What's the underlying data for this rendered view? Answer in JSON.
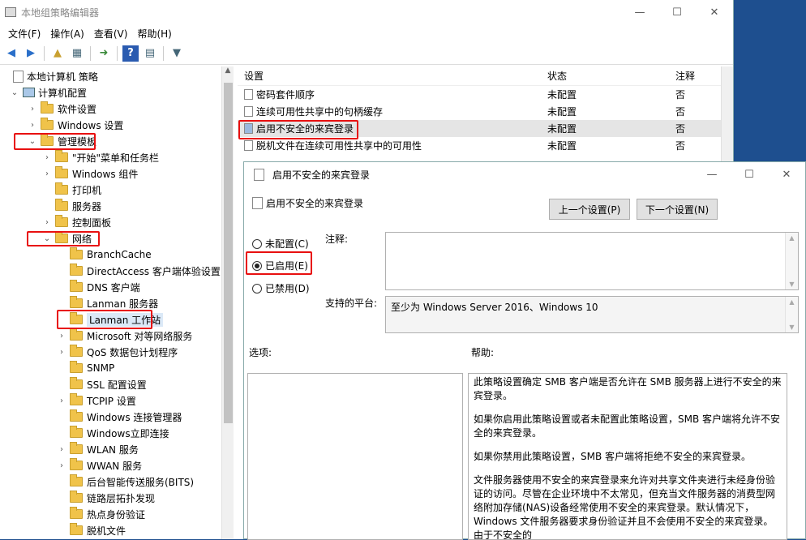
{
  "window": {
    "title": "本地组策略编辑器",
    "minimize": "—",
    "maximize": "☐",
    "close": "✕"
  },
  "menu": [
    "文件(F)",
    "操作(A)",
    "查看(V)",
    "帮助(H)"
  ],
  "tree": [
    {
      "label": "本地计算机 策略",
      "level": 0,
      "expanded": null,
      "type": "policy"
    },
    {
      "label": "计算机配置",
      "level": 1,
      "expanded": true,
      "type": "computer"
    },
    {
      "label": "软件设置",
      "level": 2,
      "expanded": false,
      "type": "folder"
    },
    {
      "label": "Windows 设置",
      "level": 2,
      "expanded": false,
      "type": "folder"
    },
    {
      "label": "管理模板",
      "level": 2,
      "expanded": true,
      "type": "folder"
    },
    {
      "label": "\"开始\"菜单和任务栏",
      "level": 3,
      "expanded": false,
      "type": "folder"
    },
    {
      "label": "Windows 组件",
      "level": 3,
      "expanded": false,
      "type": "folder"
    },
    {
      "label": "打印机",
      "level": 3,
      "expanded": null,
      "type": "folder"
    },
    {
      "label": "服务器",
      "level": 3,
      "expanded": null,
      "type": "folder"
    },
    {
      "label": "控制面板",
      "level": 3,
      "expanded": false,
      "type": "folder"
    },
    {
      "label": "网络",
      "level": 3,
      "expanded": true,
      "type": "folder"
    },
    {
      "label": "BranchCache",
      "level": 4,
      "expanded": null,
      "type": "folder"
    },
    {
      "label": "DirectAccess 客户端体验设置",
      "level": 4,
      "expanded": null,
      "type": "folder"
    },
    {
      "label": "DNS 客户端",
      "level": 4,
      "expanded": null,
      "type": "folder"
    },
    {
      "label": "Lanman 服务器",
      "level": 4,
      "expanded": null,
      "type": "folder"
    },
    {
      "label": "Lanman 工作站",
      "level": 4,
      "expanded": null,
      "type": "folder",
      "selected": true
    },
    {
      "label": "Microsoft 对等网络服务",
      "level": 4,
      "expanded": false,
      "type": "folder"
    },
    {
      "label": "QoS 数据包计划程序",
      "level": 4,
      "expanded": false,
      "type": "folder"
    },
    {
      "label": "SNMP",
      "level": 4,
      "expanded": null,
      "type": "folder"
    },
    {
      "label": "SSL 配置设置",
      "level": 4,
      "expanded": null,
      "type": "folder"
    },
    {
      "label": "TCPIP 设置",
      "level": 4,
      "expanded": false,
      "type": "folder"
    },
    {
      "label": "Windows 连接管理器",
      "level": 4,
      "expanded": null,
      "type": "folder"
    },
    {
      "label": "Windows立即连接",
      "level": 4,
      "expanded": null,
      "type": "folder"
    },
    {
      "label": "WLAN 服务",
      "level": 4,
      "expanded": false,
      "type": "folder"
    },
    {
      "label": "WWAN 服务",
      "level": 4,
      "expanded": false,
      "type": "folder"
    },
    {
      "label": "后台智能传送服务(BITS)",
      "level": 4,
      "expanded": null,
      "type": "folder"
    },
    {
      "label": "链路层拓扑发现",
      "level": 4,
      "expanded": null,
      "type": "folder"
    },
    {
      "label": "热点身份验证",
      "level": 4,
      "expanded": null,
      "type": "folder"
    },
    {
      "label": "脱机文件",
      "level": 4,
      "expanded": null,
      "type": "folder"
    }
  ],
  "list": {
    "headers": {
      "setting": "设置",
      "state": "状态",
      "comment": "注释"
    },
    "rows": [
      {
        "name": "密码套件顺序",
        "state": "未配置",
        "comment": "否"
      },
      {
        "name": "连续可用性共享中的句柄缓存",
        "state": "未配置",
        "comment": "否"
      },
      {
        "name": "启用不安全的来宾登录",
        "state": "未配置",
        "comment": "否",
        "selected": true
      },
      {
        "name": "脱机文件在连续可用性共享中的可用性",
        "state": "未配置",
        "comment": "否"
      }
    ]
  },
  "dialog": {
    "title": "启用不安全的来宾登录",
    "heading": "启用不安全的来宾登录",
    "prev_button": "上一个设置(P)",
    "next_button": "下一个设置(N)",
    "radios": [
      {
        "label": "未配置(C)",
        "checked": false
      },
      {
        "label": "已启用(E)",
        "checked": true
      },
      {
        "label": "已禁用(D)",
        "checked": false
      }
    ],
    "comment_label": "注释:",
    "platform_label": "支持的平台:",
    "platform_value": "至少为 Windows Server 2016、Windows 10",
    "options_label": "选项:",
    "help_label": "帮助:",
    "help_paragraphs": [
      "此策略设置确定 SMB 客户端是否允许在 SMB 服务器上进行不安全的来宾登录。",
      "如果你启用此策略设置或者未配置此策略设置，SMB 客户端将允许不安全的来宾登录。",
      "如果你禁用此策略设置，SMB 客户端将拒绝不安全的来宾登录。",
      "文件服务器使用不安全的来宾登录来允许对共享文件夹进行未经身份验证的访问。尽管在企业环境中不太常见，但充当文件服务器的消费型网络附加存储(NAS)设备经常使用不安全的来宾登录。默认情况下，Windows 文件服务器要求身份验证并且不会使用不安全的来宾登录。由于不安全的"
    ]
  }
}
